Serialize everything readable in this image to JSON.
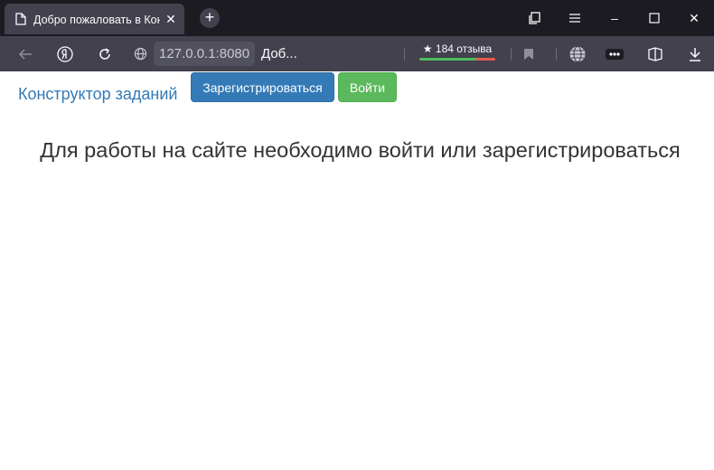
{
  "browser": {
    "tab": {
      "title": "Добро пожаловать в Конструктор заданий",
      "close_glyph": "✕"
    },
    "new_tab_glyph": "+",
    "url": {
      "host": "127.0.0.1:8080",
      "page_title": "Доб..."
    },
    "reviews": {
      "label": "★ 184 отзыва"
    },
    "window_controls": {
      "minimize": "–",
      "maximize": "☐",
      "close": "✕"
    },
    "icons": [
      "doc-icon",
      "back-arrow-icon",
      "yandex-icon",
      "reload-icon",
      "globe-icon",
      "bookmark-icon",
      "translate-globe-icon",
      "extensions-icon",
      "collections-icon",
      "download-icon",
      "menu-icon"
    ]
  },
  "page": {
    "nav": {
      "brand": "Конструктор заданий",
      "register_label": "Зарегистрироваться",
      "login_label": "Войти"
    },
    "message": "Для работы на сайте необходимо войти или зарегистрироваться"
  },
  "colors": {
    "link": "#337ab7",
    "primary": "#337ab7",
    "success": "#5cb85c",
    "text": "#333333"
  }
}
